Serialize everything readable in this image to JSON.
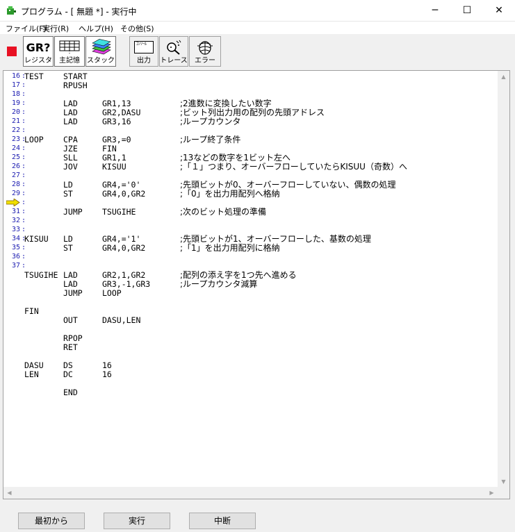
{
  "window": {
    "title": "プログラム - [ 無題 *] - 実行中",
    "minimize_glyph": "─",
    "maximize_glyph": "☐",
    "close_glyph": "✕"
  },
  "menu": [
    {
      "label": "ファイル(F)"
    },
    {
      "label": "実行(R)"
    },
    {
      "label": "ヘルプ(H)"
    },
    {
      "label": "その他(S)"
    }
  ],
  "toolbar": {
    "register": {
      "glyph": "GR?",
      "label": "レジスタ"
    },
    "memory": {
      "label": "主記憶"
    },
    "stack": {
      "label": "スタック"
    },
    "output": {
      "glyph": "ｺﾝｿｰﾙ",
      "label": "出力"
    },
    "trace": {
      "label": "トレース"
    },
    "error": {
      "label": "エラー"
    }
  },
  "editor": {
    "line_numbers": [
      "16",
      "17",
      "18",
      "19",
      "20",
      "21",
      "22",
      "23",
      "24",
      "25",
      "26",
      "27",
      "28",
      "29",
      "30",
      "31",
      "32",
      "33",
      "34",
      "35",
      "36",
      "37"
    ],
    "current_line": "30",
    "lines": [
      [
        "TEST",
        "START",
        "",
        ""
      ],
      [
        "",
        "RPUSH",
        "",
        ""
      ],
      [
        "",
        "",
        "",
        ""
      ],
      [
        "",
        "LAD",
        "GR1,13",
        ";2進数に変換したい数字"
      ],
      [
        "",
        "LAD",
        "GR2,DASU",
        ";ビット列出力用の配列の先頭アドレス"
      ],
      [
        "",
        "LAD",
        "GR3,16",
        ";ループカウンタ"
      ],
      [
        "",
        "",
        "",
        ""
      ],
      [
        "LOOP",
        "CPA",
        "GR3,=0",
        ";ループ終了条件"
      ],
      [
        "",
        "JZE",
        "FIN",
        ""
      ],
      [
        "",
        "SLL",
        "GR1,1",
        ";13などの数字を1ビット左へ"
      ],
      [
        "",
        "JOV",
        "KISUU",
        ";「１」つまり、オーバーフローしていたらKISUU（奇数）へ"
      ],
      [
        "",
        "",
        "",
        ""
      ],
      [
        "",
        "LD",
        "GR4,='0'",
        ";先頭ビットが0、オーバーフローしていない、偶数の処理"
      ],
      [
        "",
        "ST",
        "GR4,0,GR2",
        ";「0」を出力用配列へ格納"
      ],
      [
        "",
        "",
        "",
        ""
      ],
      [
        "",
        "JUMP",
        "TSUGIHE",
        ";次のビット処理の準備"
      ],
      [
        "",
        "",
        "",
        ""
      ],
      [
        "",
        "",
        "",
        ""
      ],
      [
        "KISUU",
        "LD",
        "GR4,='1'",
        ";先頭ビットが1、オーバーフローした、基数の処理"
      ],
      [
        "",
        "ST",
        "GR4,0,GR2",
        ";「1」を出力用配列に格納"
      ],
      [
        "",
        "",
        "",
        ""
      ],
      [
        "",
        "",
        "",
        ""
      ],
      [
        "TSUGIHE",
        "LAD",
        "GR2,1,GR2",
        ";配列の添え字を1つ先へ進める"
      ],
      [
        "",
        "LAD",
        "GR3,-1,GR3",
        ";ループカウンタ減算"
      ],
      [
        "",
        "JUMP",
        "LOOP",
        ""
      ],
      [
        "",
        "",
        "",
        ""
      ],
      [
        "FIN",
        "",
        "",
        ""
      ],
      [
        "",
        "OUT",
        "DASU,LEN",
        ""
      ],
      [
        "",
        "",
        "",
        ""
      ],
      [
        "",
        "RPOP",
        "",
        ""
      ],
      [
        "",
        "RET",
        "",
        ""
      ],
      [
        "",
        "",
        "",
        ""
      ],
      [
        "DASU",
        "DS",
        "16",
        ""
      ],
      [
        "LEN",
        "DC",
        "16",
        ""
      ],
      [
        "",
        "",
        "",
        ""
      ],
      [
        "",
        "END",
        "",
        ""
      ]
    ]
  },
  "buttons": {
    "restart": "最初から",
    "run": "実行",
    "abort": "中断"
  },
  "colors": {
    "line_number": "#1a1ab0",
    "stop": "#e81123",
    "arrow": "#f0e000"
  }
}
